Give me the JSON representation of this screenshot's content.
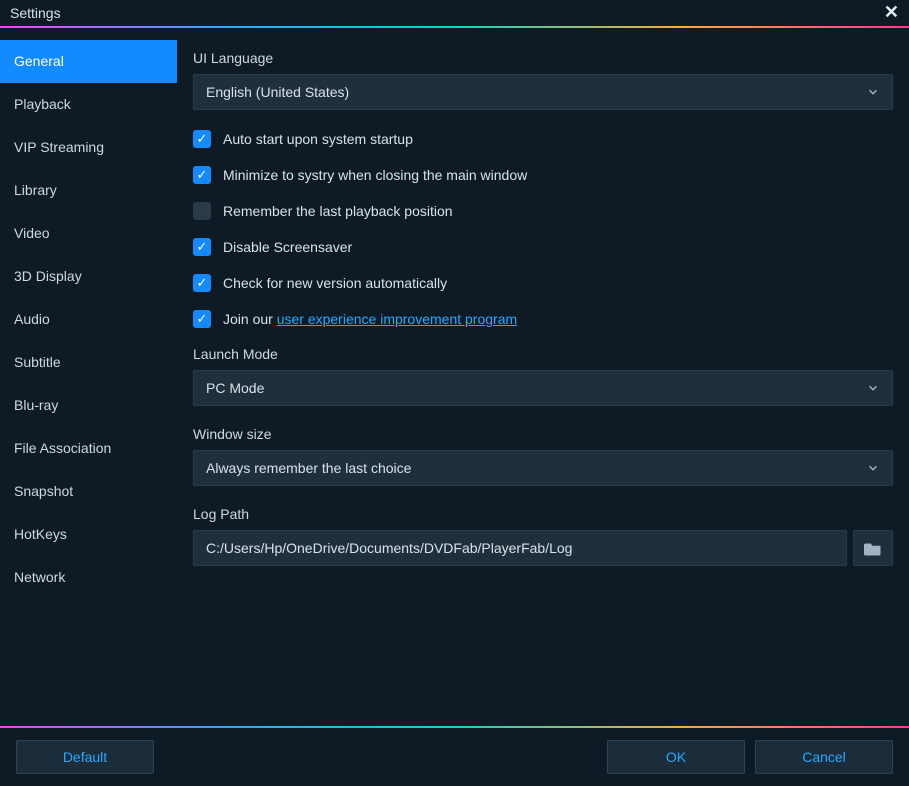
{
  "titlebar": {
    "title": "Settings",
    "close_glyph": "✕"
  },
  "sidebar": {
    "items": [
      {
        "label": "General",
        "active": true
      },
      {
        "label": "Playback",
        "active": false
      },
      {
        "label": "VIP Streaming",
        "active": false
      },
      {
        "label": "Library",
        "active": false
      },
      {
        "label": "Video",
        "active": false
      },
      {
        "label": "3D Display",
        "active": false
      },
      {
        "label": "Audio",
        "active": false
      },
      {
        "label": "Subtitle",
        "active": false
      },
      {
        "label": "Blu-ray",
        "active": false
      },
      {
        "label": "File Association",
        "active": false
      },
      {
        "label": "Snapshot",
        "active": false
      },
      {
        "label": "HotKeys",
        "active": false
      },
      {
        "label": "Network",
        "active": false
      }
    ]
  },
  "main": {
    "ui_language_label": "UI Language",
    "ui_language_value": "English (United States)",
    "check_auto_start": {
      "checked": true,
      "label": "Auto start upon system startup"
    },
    "check_minimize": {
      "checked": true,
      "label": "Minimize to systry when closing the main window"
    },
    "check_remember_pos": {
      "checked": false,
      "label": "Remember the last playback position"
    },
    "check_screensaver": {
      "checked": true,
      "label": "Disable Screensaver"
    },
    "check_update": {
      "checked": true,
      "label": "Check for new version automatically"
    },
    "check_join": {
      "checked": true,
      "label_prefix": "Join our ",
      "link_text": "user experience improvement program"
    },
    "launch_mode_label": "Launch Mode",
    "launch_mode_value": "PC Mode",
    "window_size_label": "Window size",
    "window_size_value": "Always remember the last choice",
    "log_path_label": "Log Path",
    "log_path_value": "C:/Users/Hp/OneDrive/Documents/DVDFab/PlayerFab/Log"
  },
  "footer": {
    "default_label": "Default",
    "ok_label": "OK",
    "cancel_label": "Cancel"
  }
}
